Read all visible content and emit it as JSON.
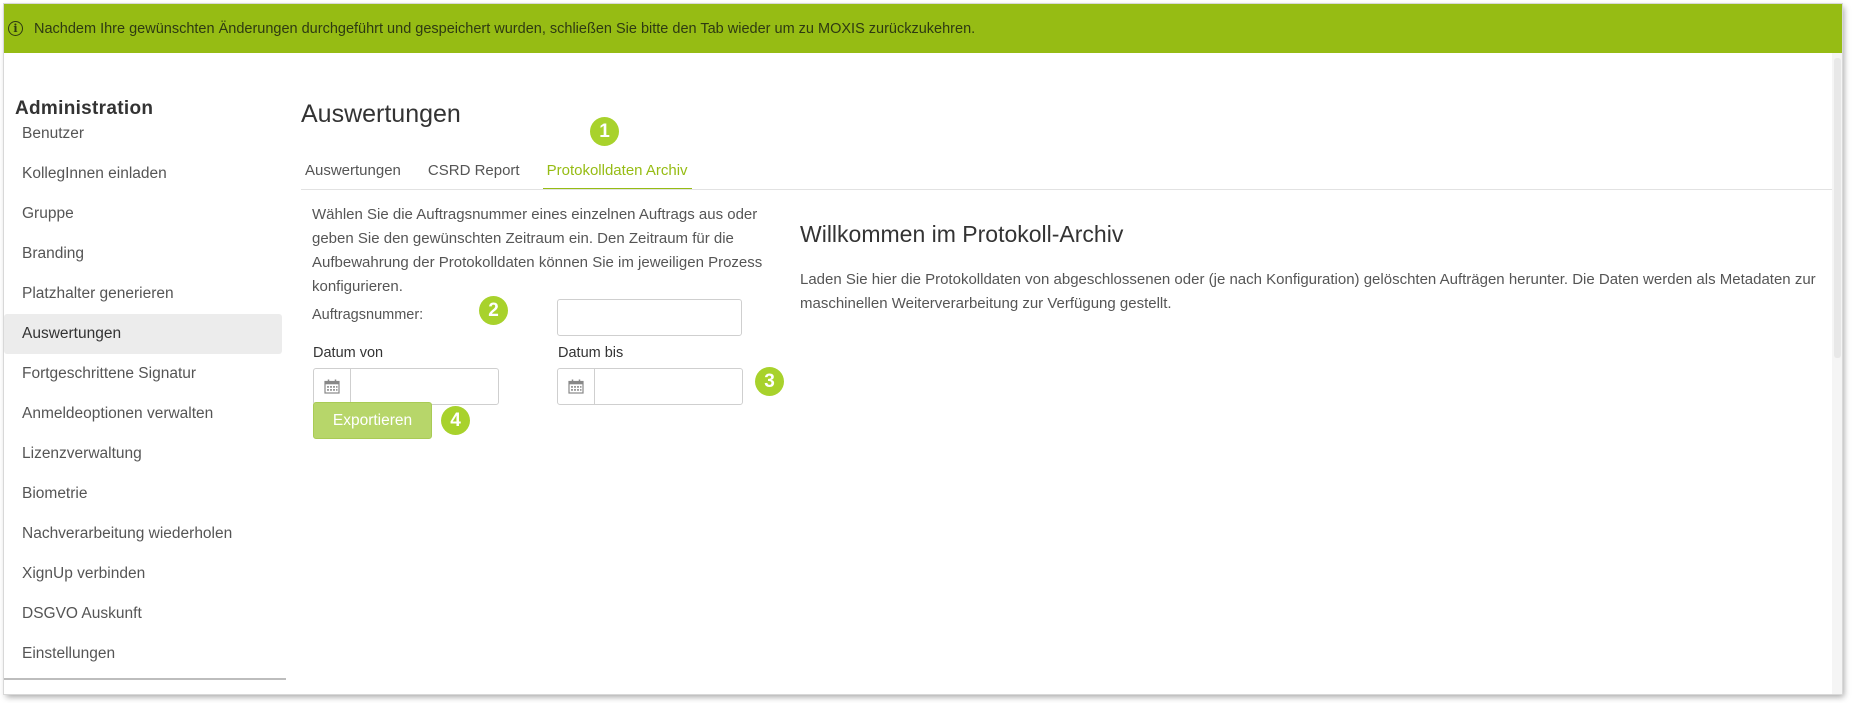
{
  "banner": {
    "icon": "info-icon",
    "text": "Nachdem Ihre gewünschten Änderungen durchgeführt und gespeichert wurden, schließen Sie bitte den Tab wieder um zu MOXIS zurückzukehren."
  },
  "sidebar": {
    "title": "Administration",
    "items": [
      {
        "label": "Benutzer",
        "active": false
      },
      {
        "label": "KollegInnen einladen",
        "active": false
      },
      {
        "label": "Gruppe",
        "active": false
      },
      {
        "label": "Branding",
        "active": false
      },
      {
        "label": "Platzhalter generieren",
        "active": false
      },
      {
        "label": "Auswertungen",
        "active": true
      },
      {
        "label": "Fortgeschrittene Signatur",
        "active": false
      },
      {
        "label": "Anmeldeoptionen verwalten",
        "active": false
      },
      {
        "label": "Lizenzverwaltung",
        "active": false
      },
      {
        "label": "Biometrie",
        "active": false
      },
      {
        "label": "Nachverarbeitung wiederholen",
        "active": false
      },
      {
        "label": "XignUp verbinden",
        "active": false
      },
      {
        "label": "DSGVO Auskunft",
        "active": false
      },
      {
        "label": "Einstellungen",
        "active": false
      }
    ]
  },
  "main": {
    "title": "Auswertungen",
    "tabs": [
      {
        "label": "Auswertungen",
        "active": false
      },
      {
        "label": "CSRD Report",
        "active": false
      },
      {
        "label": "Protokolldaten Archiv",
        "active": true
      }
    ],
    "badges": [
      "1",
      "2",
      "3",
      "4"
    ],
    "form": {
      "description": "Wählen Sie die Auftragsnummer eines einzelnen Auftrags aus oder geben Sie den gewünschten Zeitraum ein. Den Zeitraum für die Aufbewahrung der Protokolldaten können Sie im jeweiligen Prozess konfigurieren.",
      "order_label": "Auftragsnummer:",
      "order_value": "",
      "date_from_label": "Datum von",
      "date_to_label": "Datum bis",
      "date_from_value": "",
      "date_to_value": "",
      "calendar_icon": "calendar-icon",
      "export_label": "Exportieren"
    },
    "welcome": {
      "title": "Willkommen im Protokoll-Archiv",
      "text": "Laden Sie hier die Protokolldaten von abgeschlossenen oder (je nach Konfiguration) gelöschten Aufträgen herunter. Die Daten werden als Metadaten zur maschinellen Weiterverarbeitung zur Verfügung gestellt."
    }
  },
  "colors": {
    "accent": "#96bc14",
    "badge": "#a8d22c",
    "button": "#b7d66a"
  }
}
